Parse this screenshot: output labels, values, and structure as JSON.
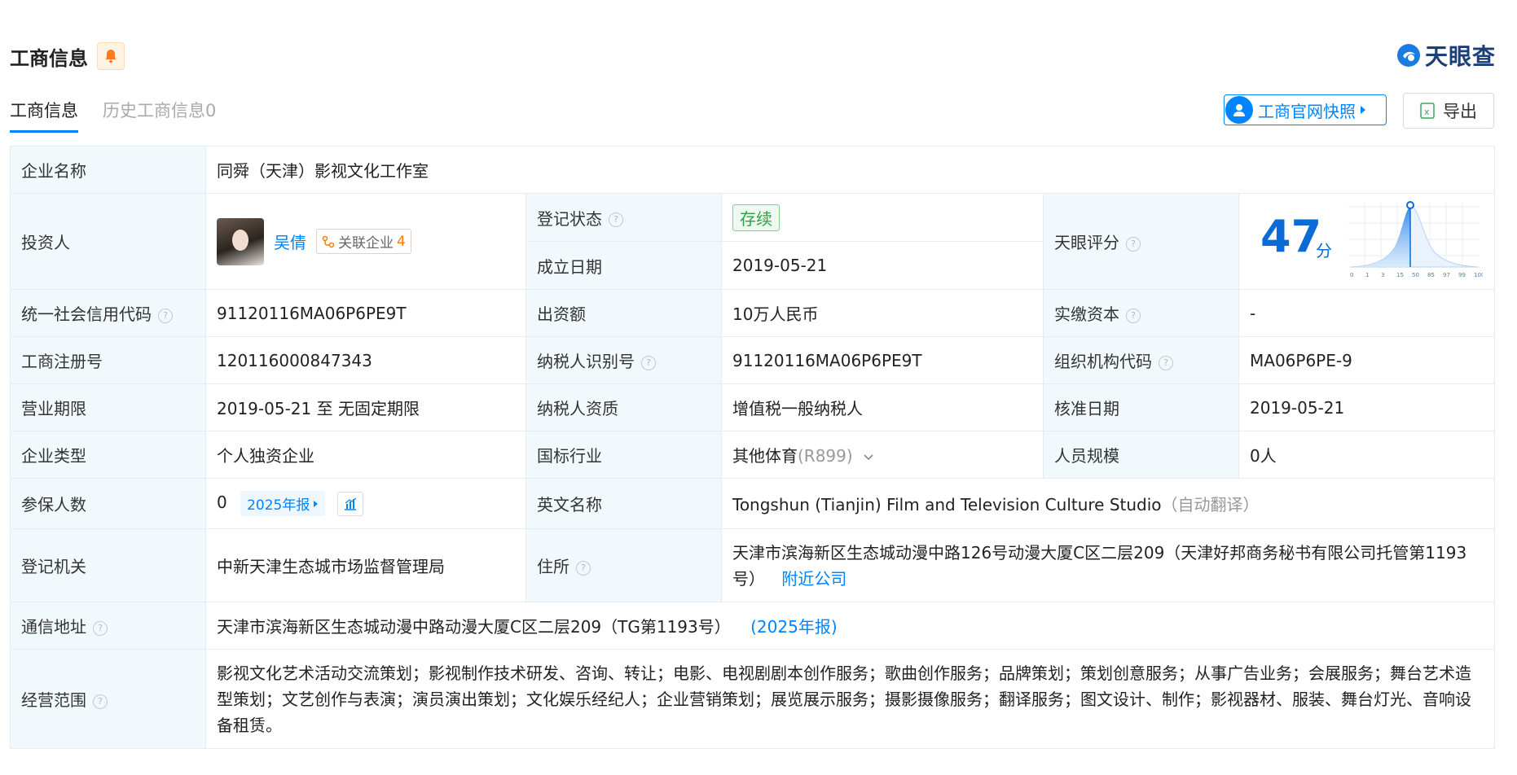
{
  "header": {
    "title": "工商信息",
    "logo_text": "天眼查"
  },
  "tabs": [
    {
      "label": "工商信息"
    },
    {
      "label": "历史工商信息0"
    }
  ],
  "buttons": {
    "snapshot": "工商官网快照",
    "export": "导出"
  },
  "table": {
    "company_name_label": "企业名称",
    "company_name": "同舜（天津）影视文化工作室",
    "investor_label": "投资人",
    "investor_name": "吴倩",
    "related_label": "关联企业",
    "related_count": "4",
    "reg_status_label": "登记状态",
    "reg_status": "存续",
    "found_date_label": "成立日期",
    "found_date": "2019-05-21",
    "tianyan_score_label": "天眼评分",
    "score_value": "47",
    "score_unit": "分",
    "score_axis": [
      "0",
      "1",
      "3",
      "15",
      "50",
      "85",
      "97",
      "99",
      "100"
    ],
    "credit_code_label": "统一社会信用代码",
    "credit_code": "91120116MA06P6PE9T",
    "capital_label": "出资额",
    "capital": "10万人民币",
    "paid_capital_label": "实缴资本",
    "paid_capital": "-",
    "reg_no_label": "工商注册号",
    "reg_no": "120116000847343",
    "taxpayer_id_label": "纳税人识别号",
    "taxpayer_id": "91120116MA06P6PE9T",
    "org_code_label": "组织机构代码",
    "org_code": "MA06P6PE-9",
    "term_label": "营业期限",
    "term": "2019-05-21 至 无固定期限",
    "taxpayer_qual_label": "纳税人资质",
    "taxpayer_qual": "增值税一般纳税人",
    "approve_date_label": "核准日期",
    "approve_date": "2019-05-21",
    "type_label": "企业类型",
    "type": "个人独资企业",
    "industry_label": "国标行业",
    "industry": "其他体育",
    "industry_code": "(R899)",
    "staff_label": "人员规模",
    "staff": "0人",
    "insured_label": "参保人数",
    "insured": "0",
    "insured_year": "2025年报",
    "english_name_label": "英文名称",
    "english_name": "Tongshun (Tianjin) Film and Television Culture Studio",
    "auto_translate": "（自动翻译）",
    "authority_label": "登记机关",
    "authority": "中新天津生态城市场监督管理局",
    "address_label": "住所",
    "address": "天津市滨海新区生态城动漫中路126号动漫大厦C区二层209（天津好邦商务秘书有限公司托管第1193号）",
    "nearby": "附近公司",
    "mail_label": "通信地址",
    "mail": "天津市滨海新区生态城动漫中路动漫大厦C区二层209（TG第1193号）",
    "mail_year": "(2025年报)",
    "scope_label": "经营范围",
    "scope": "影视文化艺术活动交流策划；影视制作技术研发、咨询、转让；电影、电视剧剧本创作服务；歌曲创作服务；品牌策划；策划创意服务；从事广告业务；会展服务；舞台艺术造型策划；文艺创作与表演；演员演出策划；文化娱乐经纪人；企业营销策划；展览展示服务；摄影摄像服务；翻译服务；图文设计、制作；影视器材、服装、舞台灯光、音响设备租赁。"
  },
  "colors": {
    "accent": "#0084ff",
    "label_bg": "#f2f9fc",
    "status_green": "#2f9e44"
  }
}
